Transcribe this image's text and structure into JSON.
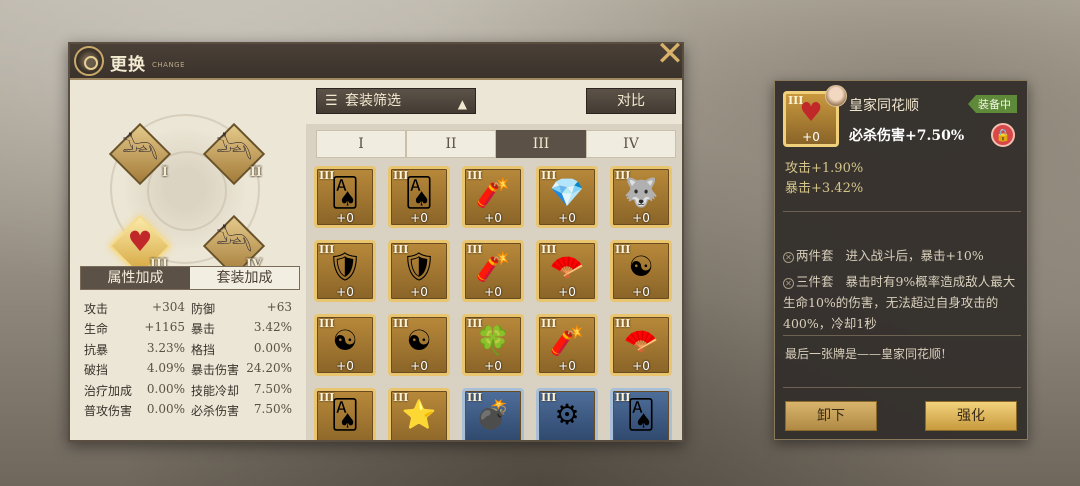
{
  "window": {
    "title": "更换",
    "subtitle": "CHANGE"
  },
  "close_label": "✕",
  "equip_slots": [
    {
      "roman": "I",
      "icon": "anubis-head-icon"
    },
    {
      "roman": "II",
      "icon": "anubis-head-icon"
    },
    {
      "roman": "III",
      "icon": "playing-cards-icon"
    },
    {
      "roman": "IV",
      "icon": "anubis-head-icon"
    }
  ],
  "attr_tabs": [
    {
      "label": "属性加成"
    },
    {
      "label": "套装加成"
    }
  ],
  "stats": [
    [
      {
        "name": "攻击",
        "value": "+304"
      },
      {
        "name": "防御",
        "value": "+63"
      }
    ],
    [
      {
        "name": "生命",
        "value": "+1165"
      },
      {
        "name": "暴击",
        "value": "3.42%"
      }
    ],
    [
      {
        "name": "抗暴",
        "value": "3.23%"
      },
      {
        "name": "格挡",
        "value": "0.00%"
      }
    ],
    [
      {
        "name": "破挡",
        "value": "4.09%"
      },
      {
        "name": "暴击伤害",
        "value": "24.20%"
      }
    ],
    [
      {
        "name": "治疗加成",
        "value": "0.00%"
      },
      {
        "name": "技能冷却",
        "value": "7.50%"
      }
    ],
    [
      {
        "name": "普攻伤害",
        "value": "0.00%"
      },
      {
        "name": "必杀伤害",
        "value": "7.50%"
      }
    ]
  ],
  "filter": {
    "label": "套装筛选",
    "icon": "list-icon",
    "arrow": "▲"
  },
  "compare_label": "对比",
  "position_tabs": [
    {
      "label": "I"
    },
    {
      "label": "II"
    },
    {
      "label": "III"
    },
    {
      "label": "IV"
    }
  ],
  "items": [
    {
      "roman": "III",
      "icon": "playing-cards-icon",
      "glyph": "🂡",
      "level": "+0",
      "rarity": "gold"
    },
    {
      "roman": "III",
      "icon": "playing-cards-icon",
      "glyph": "🂡",
      "level": "+0",
      "rarity": "gold"
    },
    {
      "roman": "III",
      "icon": "dynamite-icon",
      "glyph": "🧨",
      "level": "+0",
      "rarity": "gold"
    },
    {
      "roman": "III",
      "icon": "crystal-icon",
      "glyph": "💎",
      "level": "+0",
      "rarity": "gold"
    },
    {
      "roman": "III",
      "icon": "anubis-head-icon",
      "glyph": "🐺",
      "level": "+0",
      "rarity": "gold"
    },
    {
      "roman": "III",
      "icon": "armor-icon",
      "glyph": "🛡",
      "level": "+0",
      "rarity": "gold"
    },
    {
      "roman": "III",
      "icon": "armor-icon",
      "glyph": "🛡",
      "level": "+0",
      "rarity": "gold"
    },
    {
      "roman": "III",
      "icon": "dynamite-icon",
      "glyph": "🧨",
      "level": "+0",
      "rarity": "gold"
    },
    {
      "roman": "III",
      "icon": "fan-icon",
      "glyph": "🪭",
      "level": "+0",
      "rarity": "gold"
    },
    {
      "roman": "III",
      "icon": "yin-yang-icon",
      "glyph": "☯",
      "level": "+0",
      "rarity": "gold"
    },
    {
      "roman": "III",
      "icon": "yin-yang-icon",
      "glyph": "☯",
      "level": "+0",
      "rarity": "gold"
    },
    {
      "roman": "III",
      "icon": "yin-yang-icon",
      "glyph": "☯",
      "level": "+0",
      "rarity": "gold"
    },
    {
      "roman": "III",
      "icon": "clover-icon",
      "glyph": "🍀",
      "level": "+0",
      "rarity": "gold"
    },
    {
      "roman": "III",
      "icon": "dynamite-icon",
      "glyph": "🧨",
      "level": "+0",
      "rarity": "gold"
    },
    {
      "roman": "III",
      "icon": "fan-icon",
      "glyph": "🪭",
      "level": "+0",
      "rarity": "gold"
    },
    {
      "roman": "III",
      "icon": "playing-cards-icon",
      "glyph": "🂡",
      "level": "",
      "rarity": "gold"
    },
    {
      "roman": "III",
      "icon": "shield-star-icon",
      "glyph": "⭐",
      "level": "",
      "rarity": "gold"
    },
    {
      "roman": "III",
      "icon": "bomb-icon",
      "glyph": "💣",
      "level": "",
      "rarity": "blue"
    },
    {
      "roman": "III",
      "icon": "gear-ring-icon",
      "glyph": "⚙",
      "level": "",
      "rarity": "blue"
    },
    {
      "roman": "III",
      "icon": "playing-cards-icon",
      "glyph": "🂡",
      "level": "",
      "rarity": "blue"
    }
  ],
  "detail": {
    "roman": "III",
    "level": "+0",
    "name": "皇家同花顺",
    "badge": "装备中",
    "main_stat": "必杀伤害+7.50%",
    "sub_stats": [
      "攻击+1.90%",
      "暴击+3.42%"
    ],
    "set_bonus": [
      {
        "label": "两件套",
        "text": "进入战斗后，暴击+10%"
      },
      {
        "label": "三件套",
        "text": "暴击时有9%概率造成敌人最大生命10%的伤害，无法超过自身攻击的400%，冷却1秒"
      }
    ],
    "flavor": "最后一张牌是——皇家同花顺!",
    "unequip_label": "卸下",
    "enhance_label": "强化"
  }
}
